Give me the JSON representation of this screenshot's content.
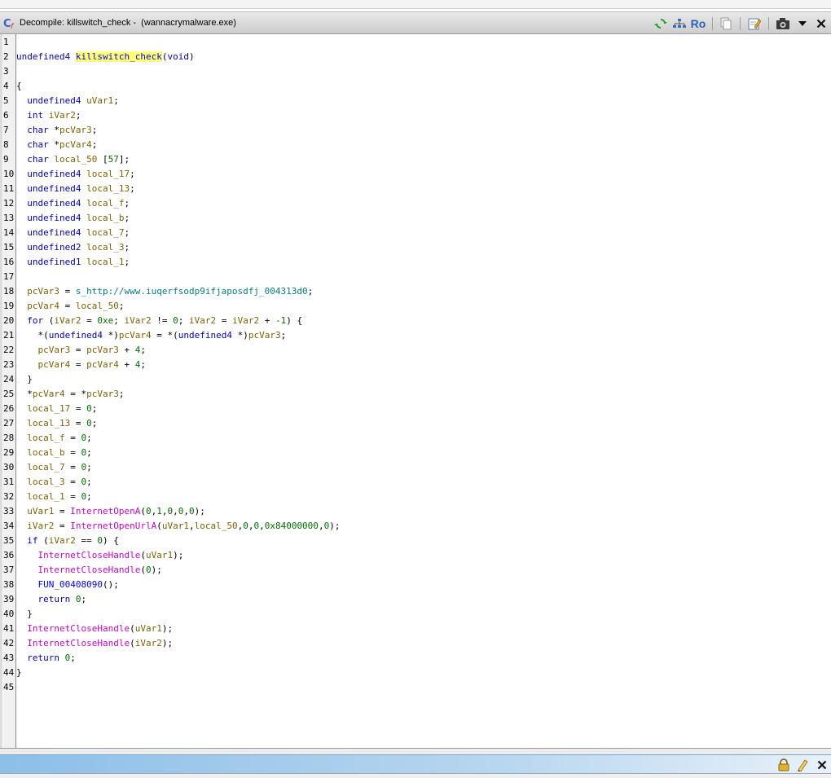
{
  "window": {
    "title": "Decompile: killswitch_check -  (wannacrymalware.exe)"
  },
  "toolbar": {
    "icons": [
      "refresh-icon",
      "graph-icon",
      "read-only-icon",
      "copy-icon",
      "edit-icon",
      "snapshot-icon",
      "menu-dropdown-icon",
      "close-icon"
    ],
    "ro_label": "Ro"
  },
  "colors": {
    "keyword": "#0000c0",
    "variable": "#806000",
    "function_name": "#0000ff",
    "call": "#d000d0",
    "number": "#007000",
    "string": "#008080",
    "highlight": "#ffff70"
  },
  "code_lines": [
    [],
    [
      [
        "undefined4 ",
        "kw"
      ],
      [
        "kill",
        "fn hl"
      ],
      [
        "switch_check",
        "fn hl"
      ],
      [
        "(",
        "p"
      ],
      [
        "void",
        "kw"
      ],
      [
        ")",
        "p"
      ]
    ],
    [],
    [
      [
        "{",
        "p"
      ]
    ],
    [
      [
        "  ",
        "p"
      ],
      [
        "undefined4 ",
        "kw"
      ],
      [
        "uVar1",
        "var"
      ],
      [
        ";",
        "p"
      ]
    ],
    [
      [
        "  ",
        "p"
      ],
      [
        "int ",
        "kw"
      ],
      [
        "iVar2",
        "var"
      ],
      [
        ";",
        "p"
      ]
    ],
    [
      [
        "  ",
        "p"
      ],
      [
        "char ",
        "kw"
      ],
      [
        "*",
        "p"
      ],
      [
        "pcVar3",
        "var"
      ],
      [
        ";",
        "p"
      ]
    ],
    [
      [
        "  ",
        "p"
      ],
      [
        "char ",
        "kw"
      ],
      [
        "*",
        "p"
      ],
      [
        "pcVar4",
        "var"
      ],
      [
        ";",
        "p"
      ]
    ],
    [
      [
        "  ",
        "p"
      ],
      [
        "char ",
        "kw"
      ],
      [
        "local_50 ",
        "var"
      ],
      [
        "[",
        "p"
      ],
      [
        "57",
        "num"
      ],
      [
        "];",
        "p"
      ]
    ],
    [
      [
        "  ",
        "p"
      ],
      [
        "undefined4 ",
        "kw"
      ],
      [
        "local_17",
        "var"
      ],
      [
        ";",
        "p"
      ]
    ],
    [
      [
        "  ",
        "p"
      ],
      [
        "undefined4 ",
        "kw"
      ],
      [
        "local_13",
        "var"
      ],
      [
        ";",
        "p"
      ]
    ],
    [
      [
        "  ",
        "p"
      ],
      [
        "undefined4 ",
        "kw"
      ],
      [
        "local_f",
        "var"
      ],
      [
        ";",
        "p"
      ]
    ],
    [
      [
        "  ",
        "p"
      ],
      [
        "undefined4 ",
        "kw"
      ],
      [
        "local_b",
        "var"
      ],
      [
        ";",
        "p"
      ]
    ],
    [
      [
        "  ",
        "p"
      ],
      [
        "undefined4 ",
        "kw"
      ],
      [
        "local_7",
        "var"
      ],
      [
        ";",
        "p"
      ]
    ],
    [
      [
        "  ",
        "p"
      ],
      [
        "undefined2 ",
        "kw"
      ],
      [
        "local_3",
        "var"
      ],
      [
        ";",
        "p"
      ]
    ],
    [
      [
        "  ",
        "p"
      ],
      [
        "undefined1 ",
        "kw"
      ],
      [
        "local_1",
        "var"
      ],
      [
        ";",
        "p"
      ]
    ],
    [],
    [
      [
        "  ",
        "p"
      ],
      [
        "pcVar3",
        "var"
      ],
      [
        " = ",
        "p"
      ],
      [
        "s_http://www.iuqerfsodp9ifjaposdfj_004313d0",
        "str"
      ],
      [
        ";",
        "p"
      ]
    ],
    [
      [
        "  ",
        "p"
      ],
      [
        "pcVar4",
        "var"
      ],
      [
        " = ",
        "p"
      ],
      [
        "local_50",
        "var"
      ],
      [
        ";",
        "p"
      ]
    ],
    [
      [
        "  ",
        "p"
      ],
      [
        "for ",
        "kw"
      ],
      [
        "(",
        "p"
      ],
      [
        "iVar2",
        "var"
      ],
      [
        " = ",
        "p"
      ],
      [
        "0xe",
        "num"
      ],
      [
        "; ",
        "p"
      ],
      [
        "iVar2",
        "var"
      ],
      [
        " != ",
        "p"
      ],
      [
        "0",
        "num"
      ],
      [
        "; ",
        "p"
      ],
      [
        "iVar2",
        "var"
      ],
      [
        " = ",
        "p"
      ],
      [
        "iVar2",
        "var"
      ],
      [
        " + ",
        "p"
      ],
      [
        "-1",
        "num"
      ],
      [
        ") {",
        "p"
      ]
    ],
    [
      [
        "    *(",
        "p"
      ],
      [
        "undefined4 ",
        "kw"
      ],
      [
        "*)",
        "p"
      ],
      [
        "pcVar4",
        "var"
      ],
      [
        " = *(",
        "p"
      ],
      [
        "undefined4 ",
        "kw"
      ],
      [
        "*)",
        "p"
      ],
      [
        "pcVar3",
        "var"
      ],
      [
        ";",
        "p"
      ]
    ],
    [
      [
        "    ",
        "p"
      ],
      [
        "pcVar3",
        "var"
      ],
      [
        " = ",
        "p"
      ],
      [
        "pcVar3",
        "var"
      ],
      [
        " + ",
        "p"
      ],
      [
        "4",
        "num"
      ],
      [
        ";",
        "p"
      ]
    ],
    [
      [
        "    ",
        "p"
      ],
      [
        "pcVar4",
        "var"
      ],
      [
        " = ",
        "p"
      ],
      [
        "pcVar4",
        "var"
      ],
      [
        " + ",
        "p"
      ],
      [
        "4",
        "num"
      ],
      [
        ";",
        "p"
      ]
    ],
    [
      [
        "  }",
        "p"
      ]
    ],
    [
      [
        "  *",
        "p"
      ],
      [
        "pcVar4",
        "var"
      ],
      [
        " = *",
        "p"
      ],
      [
        "pcVar3",
        "var"
      ],
      [
        ";",
        "p"
      ]
    ],
    [
      [
        "  ",
        "p"
      ],
      [
        "local_17",
        "var"
      ],
      [
        " = ",
        "p"
      ],
      [
        "0",
        "num"
      ],
      [
        ";",
        "p"
      ]
    ],
    [
      [
        "  ",
        "p"
      ],
      [
        "local_13",
        "var"
      ],
      [
        " = ",
        "p"
      ],
      [
        "0",
        "num"
      ],
      [
        ";",
        "p"
      ]
    ],
    [
      [
        "  ",
        "p"
      ],
      [
        "local_f",
        "var"
      ],
      [
        " = ",
        "p"
      ],
      [
        "0",
        "num"
      ],
      [
        ";",
        "p"
      ]
    ],
    [
      [
        "  ",
        "p"
      ],
      [
        "local_b",
        "var"
      ],
      [
        " = ",
        "p"
      ],
      [
        "0",
        "num"
      ],
      [
        ";",
        "p"
      ]
    ],
    [
      [
        "  ",
        "p"
      ],
      [
        "local_7",
        "var"
      ],
      [
        " = ",
        "p"
      ],
      [
        "0",
        "num"
      ],
      [
        ";",
        "p"
      ]
    ],
    [
      [
        "  ",
        "p"
      ],
      [
        "local_3",
        "var"
      ],
      [
        " = ",
        "p"
      ],
      [
        "0",
        "num"
      ],
      [
        ";",
        "p"
      ]
    ],
    [
      [
        "  ",
        "p"
      ],
      [
        "local_1",
        "var"
      ],
      [
        " = ",
        "p"
      ],
      [
        "0",
        "num"
      ],
      [
        ";",
        "p"
      ]
    ],
    [
      [
        "  ",
        "p"
      ],
      [
        "uVar1",
        "var"
      ],
      [
        " = ",
        "p"
      ],
      [
        "InternetOpenA",
        "call"
      ],
      [
        "(",
        "p"
      ],
      [
        "0",
        "num"
      ],
      [
        ",",
        "p"
      ],
      [
        "1",
        "num"
      ],
      [
        ",",
        "p"
      ],
      [
        "0",
        "num"
      ],
      [
        ",",
        "p"
      ],
      [
        "0",
        "num"
      ],
      [
        ",",
        "p"
      ],
      [
        "0",
        "num"
      ],
      [
        ");",
        "p"
      ]
    ],
    [
      [
        "  ",
        "p"
      ],
      [
        "iVar2",
        "var"
      ],
      [
        " = ",
        "p"
      ],
      [
        "InternetOpenUrlA",
        "call"
      ],
      [
        "(",
        "p"
      ],
      [
        "uVar1",
        "var"
      ],
      [
        ",",
        "p"
      ],
      [
        "local_50",
        "var"
      ],
      [
        ",",
        "p"
      ],
      [
        "0",
        "num"
      ],
      [
        ",",
        "p"
      ],
      [
        "0",
        "num"
      ],
      [
        ",",
        "p"
      ],
      [
        "0x84000000",
        "num"
      ],
      [
        ",",
        "p"
      ],
      [
        "0",
        "num"
      ],
      [
        ");",
        "p"
      ]
    ],
    [
      [
        "  ",
        "p"
      ],
      [
        "if ",
        "kw"
      ],
      [
        "(",
        "p"
      ],
      [
        "iVar2",
        "var"
      ],
      [
        " == ",
        "p"
      ],
      [
        "0",
        "num"
      ],
      [
        ") {",
        "p"
      ]
    ],
    [
      [
        "    ",
        "p"
      ],
      [
        "InternetCloseHandle",
        "call"
      ],
      [
        "(",
        "p"
      ],
      [
        "uVar1",
        "var"
      ],
      [
        ");",
        "p"
      ]
    ],
    [
      [
        "    ",
        "p"
      ],
      [
        "InternetCloseHandle",
        "call"
      ],
      [
        "(",
        "p"
      ],
      [
        "0",
        "num"
      ],
      [
        ");",
        "p"
      ]
    ],
    [
      [
        "    ",
        "p"
      ],
      [
        "FUN_00408090",
        "fn"
      ],
      [
        "();",
        "p"
      ]
    ],
    [
      [
        "    ",
        "p"
      ],
      [
        "return ",
        "kw"
      ],
      [
        "0",
        "num"
      ],
      [
        ";",
        "p"
      ]
    ],
    [
      [
        "  }",
        "p"
      ]
    ],
    [
      [
        "  ",
        "p"
      ],
      [
        "InternetCloseHandle",
        "call"
      ],
      [
        "(",
        "p"
      ],
      [
        "uVar1",
        "var"
      ],
      [
        ");",
        "p"
      ]
    ],
    [
      [
        "  ",
        "p"
      ],
      [
        "InternetCloseHandle",
        "call"
      ],
      [
        "(",
        "p"
      ],
      [
        "iVar2",
        "var"
      ],
      [
        ");",
        "p"
      ]
    ],
    [
      [
        "  ",
        "p"
      ],
      [
        "return ",
        "kw"
      ],
      [
        "0",
        "num"
      ],
      [
        ";",
        "p"
      ]
    ],
    [
      [
        "}",
        "p"
      ]
    ],
    []
  ],
  "statusbar": {
    "icons": [
      "lock-icon",
      "clear-icon",
      "close-icon"
    ]
  }
}
